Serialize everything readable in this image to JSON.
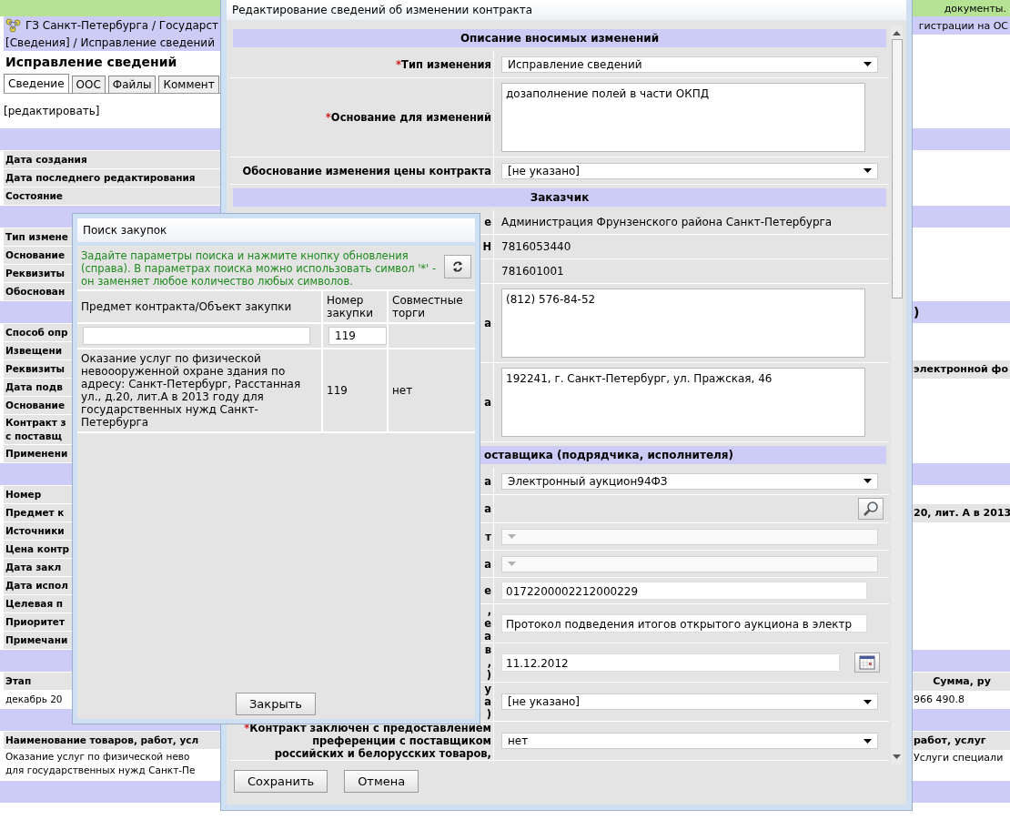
{
  "page": {
    "top_notice": "документы.",
    "breadcrumb": {
      "left": "ГЗ Санкт-Петербурга / Государст",
      "right": "гистрации на ОС"
    },
    "path": "[Сведения] / Исправление сведений",
    "title": "Исправление сведений",
    "tabs": [
      {
        "label": "Сведение",
        "selected": true
      },
      {
        "label": "ООС",
        "selected": false
      },
      {
        "label": "Файлы",
        "selected": false
      },
      {
        "label": "Коммент",
        "selected": false
      }
    ],
    "edit_link": "[редактировать]",
    "rows": [
      {
        "kind": "band"
      },
      {
        "kind": "field",
        "left": "Дата создания"
      },
      {
        "kind": "field",
        "left": "Дата последнего редактирования"
      },
      {
        "kind": "field",
        "left": "Состояние"
      },
      {
        "kind": "band"
      },
      {
        "kind": "field",
        "left": "Тип измене"
      },
      {
        "kind": "field",
        "left": "Основание"
      },
      {
        "kind": "field",
        "left": "Реквизиты"
      },
      {
        "kind": "field",
        "left": "Обоснован"
      },
      {
        "kind": "band",
        "right": ")"
      },
      {
        "kind": "field",
        "left": "Способ опр"
      },
      {
        "kind": "field",
        "left": "Извещени"
      },
      {
        "kind": "field",
        "left": "Реквизиты",
        "right": "электронной фо"
      },
      {
        "kind": "field",
        "left": "Дата подв"
      },
      {
        "kind": "field",
        "left": "Основание"
      },
      {
        "kind": "field2",
        "left": "Контракт з\nс поставщ"
      },
      {
        "kind": "field",
        "left": "Применени"
      },
      {
        "kind": "band"
      },
      {
        "kind": "field",
        "left": "Номер"
      },
      {
        "kind": "field",
        "left": "Предмет к",
        "right": "20, лит. А в 2013"
      },
      {
        "kind": "field",
        "left": "Источники"
      },
      {
        "kind": "field",
        "left": "Цена контр"
      },
      {
        "kind": "field",
        "left": "Дата закл"
      },
      {
        "kind": "field",
        "left": "Дата испол"
      },
      {
        "kind": "field",
        "left": "Целевая п"
      },
      {
        "kind": "field",
        "left": "Приоритет"
      },
      {
        "kind": "field",
        "left": "Примечани"
      },
      {
        "kind": "band"
      },
      {
        "kind": "head",
        "left": "Этап",
        "right": "Сумма, ру"
      },
      {
        "kind": "text",
        "left": "декабрь 20",
        "right": "966 490.8"
      },
      {
        "kind": "band"
      },
      {
        "kind": "head2",
        "left": "Наименование товаров, работ, усл",
        "right": "работ, услуг"
      },
      {
        "kind": "text2",
        "left": "Оказание услуг по физической нево\nдля государственных нужд Санкт-Пе",
        "right": "Услуги специали"
      },
      {
        "kind": "band"
      }
    ]
  },
  "edit_dialog": {
    "title": "Редактирование сведений об изменении контракта",
    "rows": [
      {
        "kind": "section",
        "label": "Описание вносимых изменений"
      },
      {
        "kind": "select",
        "required_mark": "*",
        "label": "Тип изменения",
        "value": "Исправление сведений",
        "disabled": false
      },
      {
        "kind": "textarea",
        "required_mark": "*",
        "label": "Основание для изменений",
        "value": "дозаполнение полей в части ОКПД"
      },
      {
        "kind": "select",
        "label": "Обоснование изменения цены контракта",
        "value": "[не указано]",
        "disabled": false
      },
      {
        "kind": "section",
        "label": "Заказчик"
      },
      {
        "kind": "text",
        "label": "е",
        "value": "Администрация Фрунзенского района Санкт-Петербурга"
      },
      {
        "kind": "text",
        "label": "Н",
        "value": "7816053440"
      },
      {
        "kind": "text",
        "value": "781601001"
      },
      {
        "kind": "textarea",
        "label": "а",
        "value": "(812) 576-84-52"
      },
      {
        "kind": "textarea",
        "label": "а",
        "value": "192241, г. Санкт-Петербург, ул. Пражская, 46"
      },
      {
        "kind": "section_partial",
        "label": "оставщика (подрядчика, исполнителя)"
      },
      {
        "kind": "select",
        "label": "а",
        "value": "Электронный аукцион94ФЗ",
        "disabled": false
      },
      {
        "kind": "lookup",
        "label": "а"
      },
      {
        "kind": "select",
        "label": "т",
        "disabled": true
      },
      {
        "kind": "select",
        "label": "а",
        "disabled": true
      },
      {
        "kind": "input",
        "label": "е",
        "value": "0172200002212000229"
      },
      {
        "kind": "input",
        "label": ",\nе\nа",
        "value": "Протокол подведения итогов открытого аукциона в электр"
      },
      {
        "kind": "date",
        "label": "в\n,\n)",
        "value": "11.12.2012"
      },
      {
        "kind": "select",
        "label": "у\nа\n)",
        "value": "[не указано]",
        "disabled": false
      },
      {
        "kind": "select",
        "required_mark": "*",
        "label": "Контракт заключен с предоставлением\nпреференции с поставщиком\nроссийских и белорусских товаров,",
        "value": "нет",
        "disabled": false
      }
    ],
    "buttons": [
      "Сохранить",
      "Отмена"
    ]
  },
  "search_dialog": {
    "title": "Поиск закупок",
    "hint": "Задайте параметры поиска и нажмите кнопку обновления (справа). В параметрах поиска можно использовать символ '*' - он заменяет любое количество любых символов.",
    "columns": [
      "Предмет контракта/Объект закупки",
      "Номер закупки",
      "Совместные торги"
    ],
    "number_filter": "119",
    "results": [
      {
        "subject": "Оказание услуг по физической невоооруженной охране здания по адресу: Санкт-Петербург, Расстанная ул., д.20, лит.А в 2013 году для государственных нужд Санкт-Петербурга",
        "number": "119",
        "joint": "нет"
      }
    ],
    "close_button": "Закрыть"
  }
}
